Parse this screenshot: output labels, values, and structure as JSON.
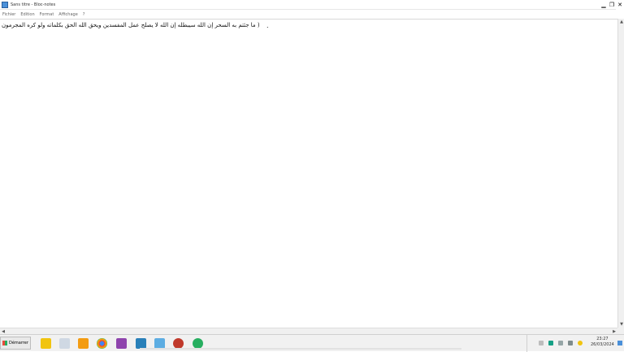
{
  "window": {
    "title": "Sans titre - Bloc-notes",
    "controls": {
      "minimize": "▁",
      "restore": "❐",
      "close": "✕"
    }
  },
  "menu": {
    "items": [
      "Fichier",
      "Edition",
      "Format",
      "Affichage",
      "?"
    ]
  },
  "editor": {
    "text": "( ما جئتم به السحر إن الله سيبطله إن الله لا يصلح عمل المفسدين ويحق الله الحق بكلماته ولو كره المجرمون",
    "mark": "."
  },
  "taskbar": {
    "start_label": "Démarrer",
    "clock_time": "23:27",
    "clock_date": "26/03/2024"
  },
  "colors": {
    "start_logo": "#e74c3c",
    "accent": "#4a90d9"
  }
}
